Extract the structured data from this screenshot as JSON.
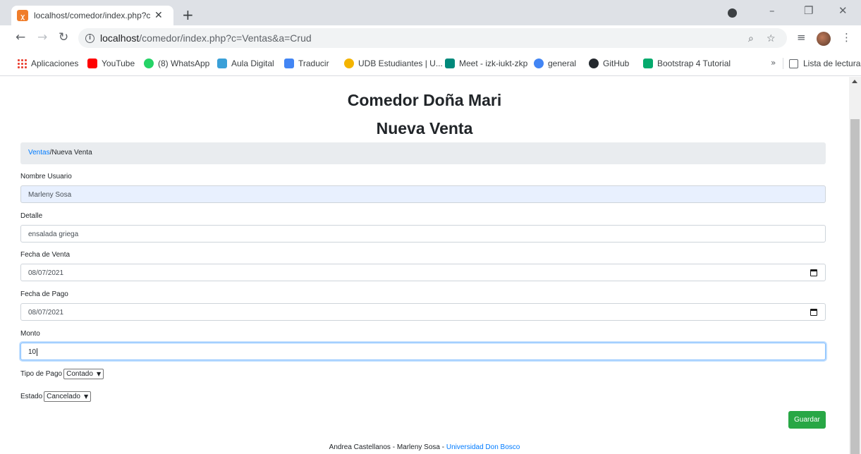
{
  "browser": {
    "tab_title": "localhost/comedor/index.php?c=",
    "url_host": "localhost",
    "url_path": "/comedor/index.php?c=Ventas&a=Crud",
    "bookmarks": [
      {
        "label": "Aplicaciones",
        "icon": "apps-grid-icon",
        "color": "#ea4335"
      },
      {
        "label": "YouTube",
        "icon": "youtube-icon",
        "color": "#ff0000"
      },
      {
        "label": "(8) WhatsApp",
        "icon": "whatsapp-icon",
        "color": "#25d366"
      },
      {
        "label": "Aula Digital",
        "icon": "aula-digital-icon",
        "color": "#3aa0d8"
      },
      {
        "label": "Traducir",
        "icon": "translate-icon",
        "color": "#4285f4"
      },
      {
        "label": "UDB Estudiantes | U...",
        "icon": "udb-icon",
        "color": "#f4b400"
      },
      {
        "label": "Meet - izk-iukt-zkp",
        "icon": "meet-icon",
        "color": "#00897b"
      },
      {
        "label": "general",
        "icon": "general-icon",
        "color": "#4285f4"
      },
      {
        "label": "GitHub",
        "icon": "github-icon",
        "color": "#24292e"
      },
      {
        "label": "Bootstrap 4 Tutorial",
        "icon": "w3-icon",
        "color": "#04aa6d"
      }
    ],
    "more_bookmarks": "»",
    "reading_list": "Lista de lectura"
  },
  "page": {
    "title": "Comedor Doña Mari",
    "subtitle": "Nueva Venta",
    "breadcrumb_link": "Ventas",
    "breadcrumb_current": "/Nueva Venta"
  },
  "form": {
    "nombre_label": "Nombre Usuario",
    "nombre_value": "Marleny Sosa",
    "detalle_label": "Detalle",
    "detalle_value": "ensalada griega",
    "fecha_venta_label": "Fecha de Venta",
    "fecha_venta_value": "08/07/2021",
    "fecha_pago_label": "Fecha de Pago",
    "fecha_pago_value": "08/07/2021",
    "monto_label": "Monto",
    "monto_value": "10",
    "tipo_pago_label": "Tipo de Pago",
    "tipo_pago_value": "Contado",
    "estado_label": "Estado",
    "estado_value": "Cancelado",
    "save_label": "Guardar"
  },
  "footer": {
    "authors": "Andrea Castellanos - Marleny Sosa - ",
    "university": "Universidad Don Bosco"
  }
}
